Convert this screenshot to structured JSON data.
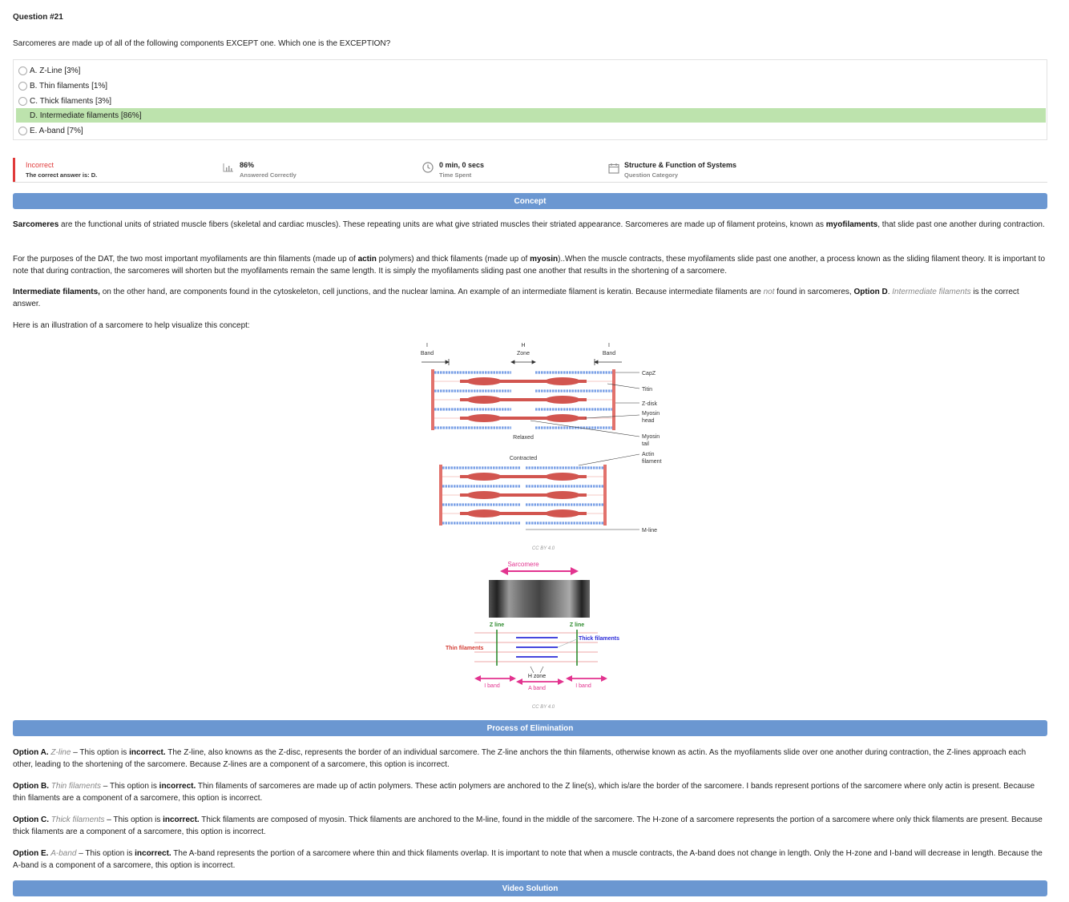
{
  "question": {
    "title": "Question #21",
    "text": "Sarcomeres are made up of all of the following components EXCEPT one. Which one is the EXCEPTION?",
    "choices": [
      {
        "label": "A. Z-Line [3%]",
        "correct": false
      },
      {
        "label": "B. Thin filaments [1%]",
        "correct": false
      },
      {
        "label": "C. Thick filaments [3%]",
        "correct": false
      },
      {
        "label": "D. Intermediate filaments [86%]",
        "correct": true
      },
      {
        "label": "E. A-band [7%]",
        "correct": false
      }
    ]
  },
  "stats": {
    "result": "Incorrect",
    "result_sub": "The correct answer is: D.",
    "percent": "86%",
    "percent_sub": "Answered Correctly",
    "time": "0 min, 0 secs",
    "time_sub": "Time Spent",
    "category": "Structure & Function of Systems",
    "category_sub": "Question Category",
    "colors": {
      "incorrect": "#e03a3a",
      "correct_bg": "#bde3ad",
      "section_bar": "#6b97d1"
    }
  },
  "sections": {
    "concept": "Concept",
    "elimination": "Process of Elimination",
    "video": "Video Solution"
  },
  "concept": {
    "p1_b1": "Sarcomeres",
    "p1_t1": " are the functional units of striated muscle fibers (skeletal and cardiac muscles). These repeating units are what give striated muscles their striated appearance.  Sarcomeres are made up of filament proteins, known as ",
    "p1_b2": "myofilaments",
    "p1_t2": ", that slide past one another during contraction.",
    "p2_t1": "For the purposes of the DAT, the two most important myofilaments are thin filaments (made up of ",
    "p2_b1": "actin",
    "p2_t2": " polymers) and thick filaments (made up of ",
    "p2_b2": "myosin",
    "p2_t3": ")..When the muscle contracts, these myofilaments slide past one another, a process known as the sliding filament theory. It is important to note that during contraction, the sarcomeres will shorten but the myofilaments remain the same length. It is simply the myofilaments sliding past one another that results in the shortening of a sarcomere.",
    "p3_b1": "Intermediate filaments,",
    "p3_t1": " on the other hand, are components found in the cytoskeleton, cell junctions, and the nuclear lamina. An example of an intermediate filament is keratin. Because intermediate filaments are ",
    "p3_i1": "not",
    "p3_t2": " found in sarcomeres, ",
    "p3_b2": "Option D",
    "p3_t3": ". ",
    "p3_i2": "Intermediate filaments",
    "p3_t4": " is the correct answer.",
    "p4": "Here is an illustration of a sarcomere to help visualize this concept:"
  },
  "figure1": {
    "i_band": "I",
    "band": "Band",
    "h": "H",
    "zone": "Zone",
    "labels": [
      "CapZ",
      "Titin",
      "Z-disk",
      "Myosin",
      "head",
      "Myosin",
      "tail",
      "Actin",
      "filament",
      "M-line"
    ],
    "relaxed": "Relaxed",
    "contracted": "Contracted",
    "credit": "CC BY 4.0"
  },
  "figure2": {
    "sarcomere": "Sarcomere",
    "z_line": "Z line",
    "thick": "Thick filaments",
    "thin": "Thin filaments",
    "h_zone": "H zone",
    "i_band": "I band",
    "a_band": "A band",
    "credit": "CC BY 4.0"
  },
  "elimination": {
    "a_b": "Option A.",
    "a_i": "Z-line",
    "a_t1": " – This option is ",
    "a_b2": "incorrect.",
    "a_t2": "  The Z-line, also knowns as the Z-disc, represents the border of an individual sarcomere. The Z-line anchors the thin filaments, otherwise known as actin. As the myofilaments slide over one another during contraction, the Z-lines approach each other, leading to the shortening of the sarcomere. Because Z-lines are a component of a sarcomere, this option is incorrect.",
    "b_b": "Option B.",
    "b_i": "Thin filaments",
    "b_t1": " – This option is ",
    "b_b2": "incorrect.",
    "b_t2": " Thin filaments of sarcomeres are made up of actin polymers. These actin polymers are anchored to the Z line(s), which is/are the border of the sarcomere. I bands represent portions of the sarcomere where only actin is present. Because thin filaments are a component of a sarcomere, this option is incorrect.",
    "c_b": "Option C.",
    "c_i": "Thick filaments",
    "c_t1": " – This option is ",
    "c_b2": "incorrect.",
    "c_t2": "  Thick filaments are composed of myosin. Thick filaments are anchored to the M-line, found in the middle of the sarcomere. The H-zone of a sarcomere represents the portion of a sarcomere where only thick filaments are present. Because thick filaments are a component of a sarcomere, this option is incorrect.",
    "e_b": "Option E.",
    "e_i": "A-band",
    "e_t1": " – This option is ",
    "e_b2": "incorrect.",
    "e_t2": "  The A-band represents the portion of a sarcomere where thin and thick filaments overlap. It is important to note that when a muscle contracts, the A-band does not change in length. Only the H-zone and I-band will decrease in length. Because the A-band is a component of a sarcomere, this option is incorrect."
  }
}
